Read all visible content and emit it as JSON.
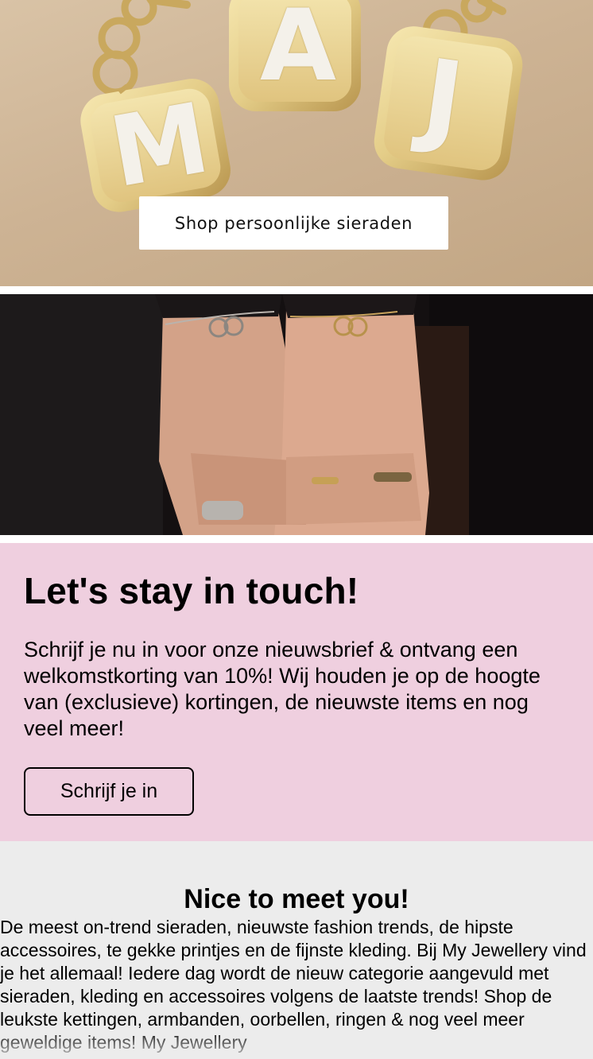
{
  "hero_personal": {
    "button_label": "Shop persoonlijke sieraden",
    "pendant_letters": [
      "M",
      "A",
      "J"
    ]
  },
  "newsletter": {
    "title": "Let's stay in touch!",
    "text": "Schrijf je nu in voor onze nieuwsbrief & ontvang een welkomstkorting van 10%! Wij houden je op de hoogte van (exclusieve) kortingen, de nieuwste items en nog veel meer!",
    "button_label": "Schrijf je in",
    "background_color": "#efcfdf"
  },
  "about": {
    "title": "Nice to meet you!",
    "text": "De meest on-trend sieraden, nieuwste fashion trends, de hipste accessoires, te gekke printjes en de fijnste kleding. Bij My Jewellery vind je het allemaal! Iedere dag wordt de nieuw categorie aangevuld met sieraden, kleding en accessoires volgens de laatste trends! Shop de leukste kettingen, armbanden, oorbellen, ringen & nog veel meer geweldige items! My Jewellery"
  }
}
